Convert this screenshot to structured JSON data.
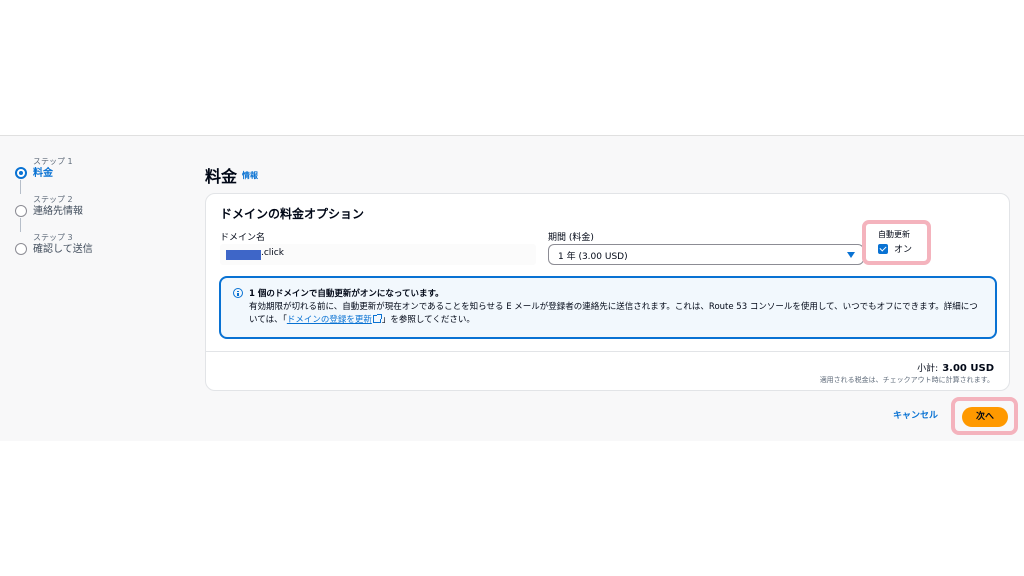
{
  "steps": [
    {
      "caption": "ステップ 1",
      "label": "料金"
    },
    {
      "caption": "ステップ 2",
      "label": "連絡先情報"
    },
    {
      "caption": "ステップ 3",
      "label": "確認して送信"
    }
  ],
  "header": {
    "title": "料金",
    "info": "情報"
  },
  "card": {
    "title": "ドメインの料金オプション",
    "domain_label": "ドメイン名",
    "domain_suffix": ".click",
    "duration_label": "期間 (料金)",
    "duration_value": "1 年 (3.00 USD)",
    "auto_renew_label": "自動更新",
    "auto_renew_value": "オン"
  },
  "alert": {
    "title": "1 個のドメインで自動更新がオンになっています。",
    "body_before": "有効期限が切れる前に、自動更新が現在オンであることを知らせる E メールが登録者の連絡先に送信されます。これは、Route 53 コンソールを使用して、いつでもオフにできます。詳細については、「",
    "link": "ドメインの登録を更新",
    "body_after": "」を参照してください。"
  },
  "summary": {
    "subtotal_label": "小計:",
    "subtotal_value": "3.00 USD",
    "tax_note": "適用される税金は、チェックアウト時に計算されます。"
  },
  "footer": {
    "cancel": "キャンセル",
    "next": "次へ"
  },
  "colors": {
    "primary": "#0972d3",
    "accent": "#ff9900",
    "highlight": "#f4b3bd"
  }
}
